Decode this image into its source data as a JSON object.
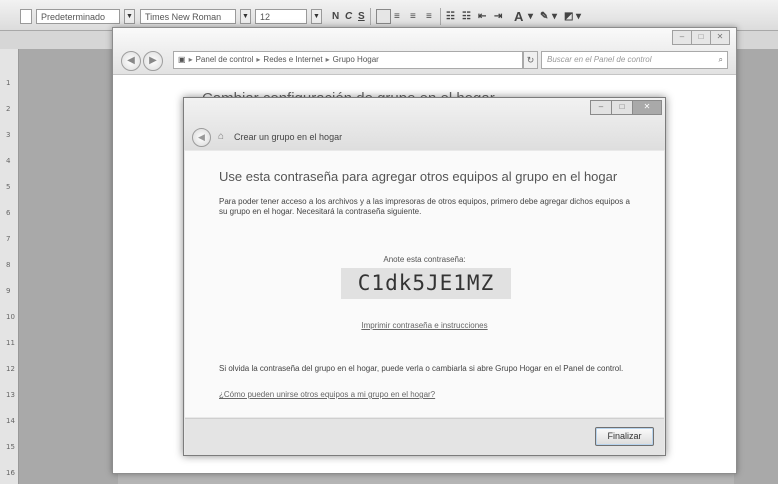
{
  "toolbar": {
    "style_value": "Predeterminado",
    "font_value": "Times New Roman",
    "size_value": "12",
    "bold": "N",
    "italic": "C",
    "underline": "S"
  },
  "ruler": {
    "marks": [
      "1",
      "2",
      "3",
      "4",
      "5",
      "6",
      "7",
      "8",
      "9",
      "10",
      "11",
      "12",
      "13",
      "14",
      "15",
      "16"
    ]
  },
  "explorer": {
    "window_buttons": [
      "–",
      "□",
      "✕"
    ],
    "breadcrumb": [
      "Panel de control",
      "Redes e Internet",
      "Grupo Hogar"
    ],
    "search_placeholder": "Buscar en el Panel de control",
    "behind_title": "Cambiar configuración de grupo en el hogar"
  },
  "dialog": {
    "title": "Crear un grupo en el hogar",
    "heading": "Use esta contraseña para agregar otros equipos al grupo en el hogar",
    "intro": "Para poder tener acceso a los archivos y a las impresoras de otros equipos, primero debe agregar dichos equipos a su grupo en el hogar. Necesitará la contraseña siguiente.",
    "password_label": "Anote esta contraseña:",
    "password": "C1dk5JE1MZ",
    "print_link": "Imprimir contraseña e instrucciones",
    "forgot_text": "Si olvida la contraseña del grupo en el hogar, puede verla o cambiarla si abre Grupo Hogar en el Panel de control.",
    "help_link": "¿Cómo pueden unirse otros equipos a mi grupo en el hogar?",
    "finish_button": "Finalizar"
  },
  "colors": {
    "accent_button_glow": "#b8d4ee",
    "window_border": "#8d8d8d"
  },
  "icons": [
    "back-arrow-icon",
    "forward-arrow-icon",
    "control-panel-icon",
    "refresh-icon",
    "search-icon",
    "homegroup-icon"
  ]
}
